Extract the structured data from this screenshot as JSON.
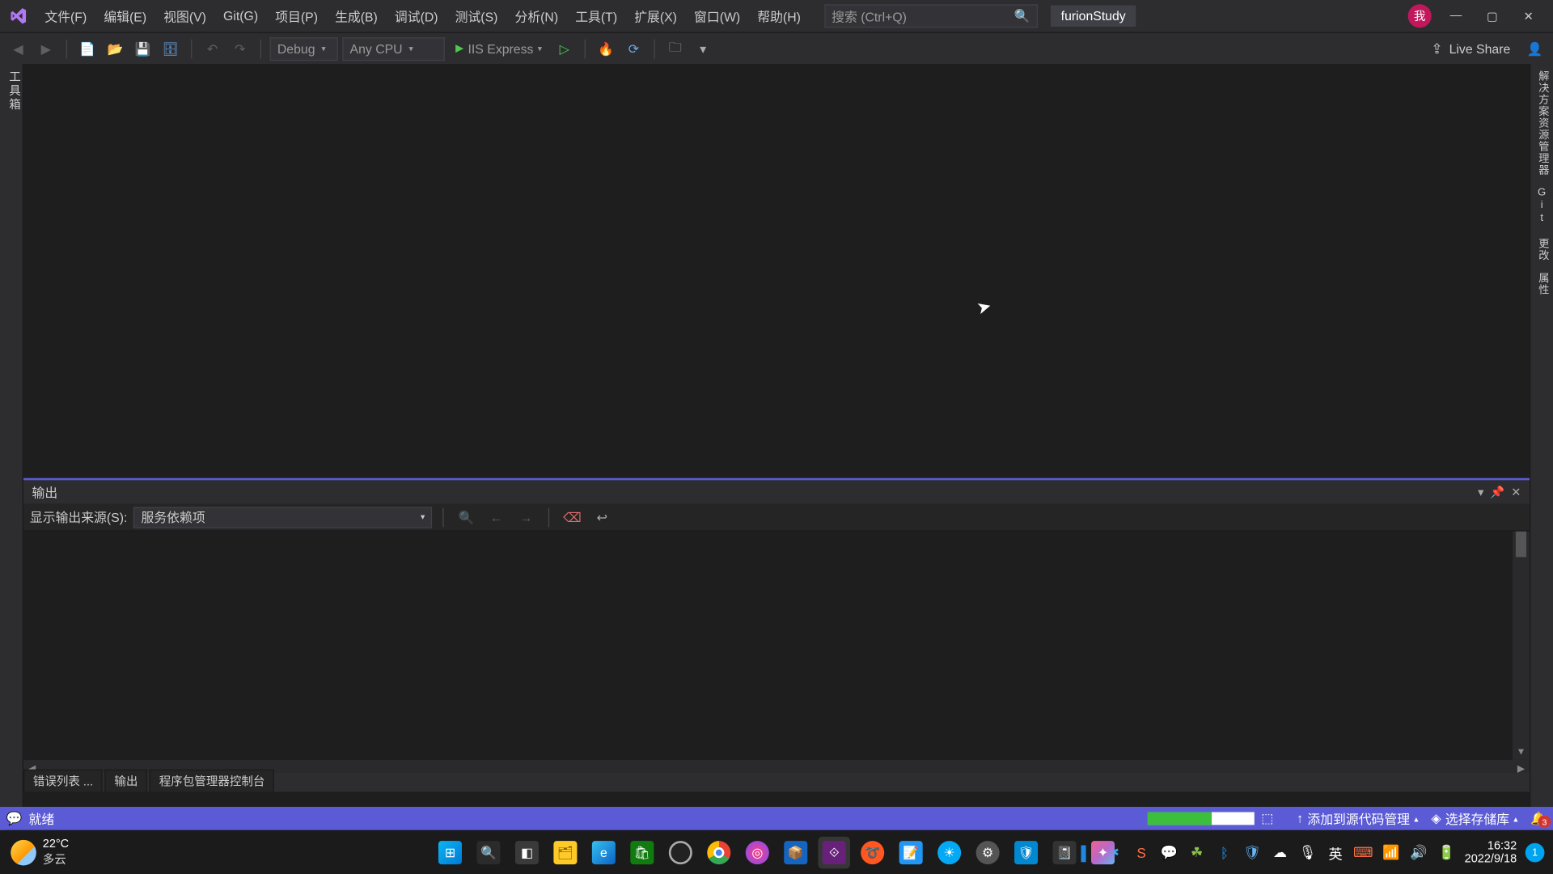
{
  "menu": {
    "items": [
      "文件(F)",
      "编辑(E)",
      "视图(V)",
      "Git(G)",
      "项目(P)",
      "生成(B)",
      "调试(D)",
      "测试(S)",
      "分析(N)",
      "工具(T)",
      "扩展(X)",
      "窗口(W)",
      "帮助(H)"
    ],
    "search_placeholder": "搜索 (Ctrl+Q)",
    "project_name": "furionStudy",
    "avatar_text": "我"
  },
  "toolbar": {
    "config": "Debug",
    "platform": "Any CPU",
    "run_target": "IIS Express",
    "live_share": "Live Share"
  },
  "left_tab": "工具箱",
  "right_tabs": [
    "解决方案资源管理器",
    "Git 更改",
    "属性"
  ],
  "output": {
    "title": "输出",
    "source_label": "显示输出来源(S):",
    "source_value": "服务依赖项"
  },
  "bottom_tabs": [
    "错误列表 ...",
    "输出",
    "程序包管理器控制台"
  ],
  "statusbar": {
    "ready": "就绪",
    "progress_pct": 60,
    "src_ctrl": "添加到源代码管理",
    "repo": "选择存储库",
    "notif_count": "3"
  },
  "taskbar": {
    "weather_temp": "22°C",
    "weather_desc": "多云",
    "time": "16:32",
    "date": "2022/9/18",
    "onedrive_badge": "1"
  }
}
